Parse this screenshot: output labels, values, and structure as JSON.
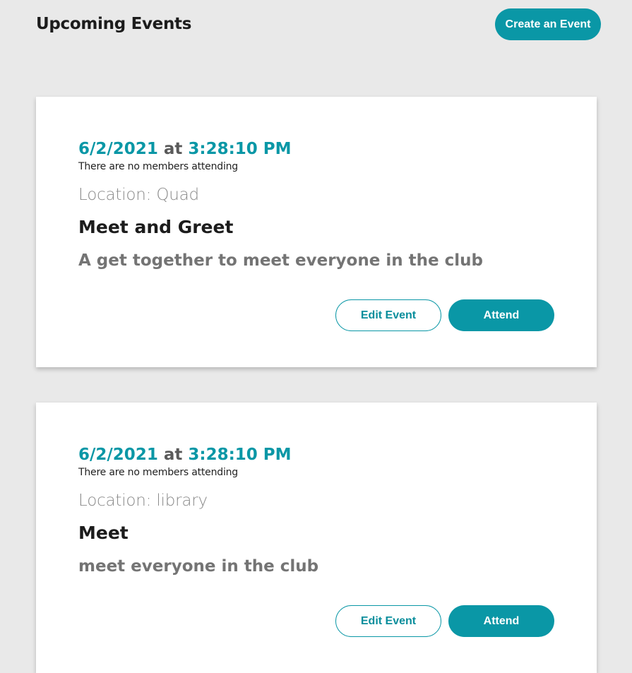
{
  "header": {
    "title": "Upcoming Events",
    "create_label": "Create an Event"
  },
  "events": [
    {
      "date": "6/2/2021",
      "at": "at",
      "time": "3:28:10 PM",
      "attendance": "There are no members attending",
      "location": "Location: Quad",
      "name": "Meet and Greet",
      "description": "A get together to meet everyone in the club",
      "edit_label": "Edit Event",
      "attend_label": "Attend"
    },
    {
      "date": "6/2/2021",
      "at": "at",
      "time": "3:28:10 PM",
      "attendance": "There are no members attending",
      "location": "Location: library",
      "name": "Meet",
      "description": "meet everyone in the club",
      "edit_label": "Edit Event",
      "attend_label": "Attend"
    }
  ],
  "colors": {
    "accent": "#0a97a6",
    "background": "#e9e9e9",
    "card": "#ffffff"
  }
}
